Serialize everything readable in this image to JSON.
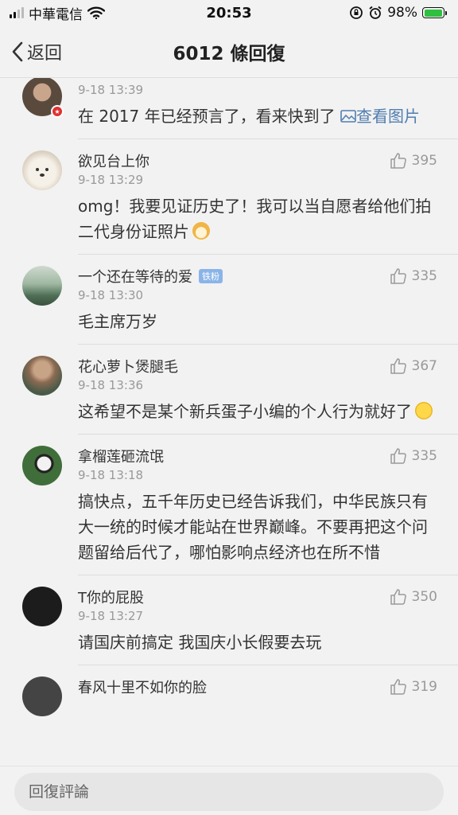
{
  "status_bar": {
    "carrier": "中華電信",
    "time": "20:53",
    "battery": "98%",
    "battery_level": 0.98
  },
  "nav": {
    "back_label": "返回",
    "title": "6012 條回復"
  },
  "comments": [
    {
      "name": "",
      "badge": "",
      "time": "9-18 13:39",
      "likes": "",
      "text": "在 2017 年已经预言了，看来快到了",
      "link": "查看图片",
      "avatar_color": "#5a4a3e"
    },
    {
      "name": "欲见台上你",
      "badge": "",
      "time": "9-18 13:29",
      "likes": "395",
      "text": "omg！我要见证历史了！我可以当自愿者给他们拍二代身份证照片",
      "emoji": "dog-face",
      "avatar_color": "#e8dfd2"
    },
    {
      "name": "一个还在等待的爱",
      "badge": "铁粉",
      "time": "9-18 13:30",
      "likes": "335",
      "text": "毛主席万岁",
      "avatar_color": "#7f9a86"
    },
    {
      "name": "花心萝卜煲腿毛",
      "badge": "",
      "time": "9-18 13:36",
      "likes": "367",
      "text": "这希望不是某个新兵蛋子小编的个人行为就好了",
      "emoji": "crying-face",
      "avatar_color": "#8a6a52"
    },
    {
      "name": "拿榴莲砸流氓",
      "badge": "",
      "time": "9-18 13:18",
      "likes": "335",
      "text": "搞快点，五千年历史已经告诉我们，中华民族只有大一统的时候才能站在世界巅峰。不要再把这个问题留给后代了，哪怕影响点经济也在所不惜",
      "avatar_color": "#3f6e3a"
    },
    {
      "name": "T你的屁股",
      "badge": "",
      "time": "9-18 13:27",
      "likes": "350",
      "text": "请国庆前搞定 我国庆小长假要去玩",
      "avatar_color": "#1c1c1c"
    },
    {
      "name": "春风十里不如你的脸",
      "badge": "",
      "time": "",
      "likes": "319",
      "text": "",
      "avatar_color": "#444444"
    }
  ],
  "reply": {
    "placeholder": "回復評論"
  }
}
